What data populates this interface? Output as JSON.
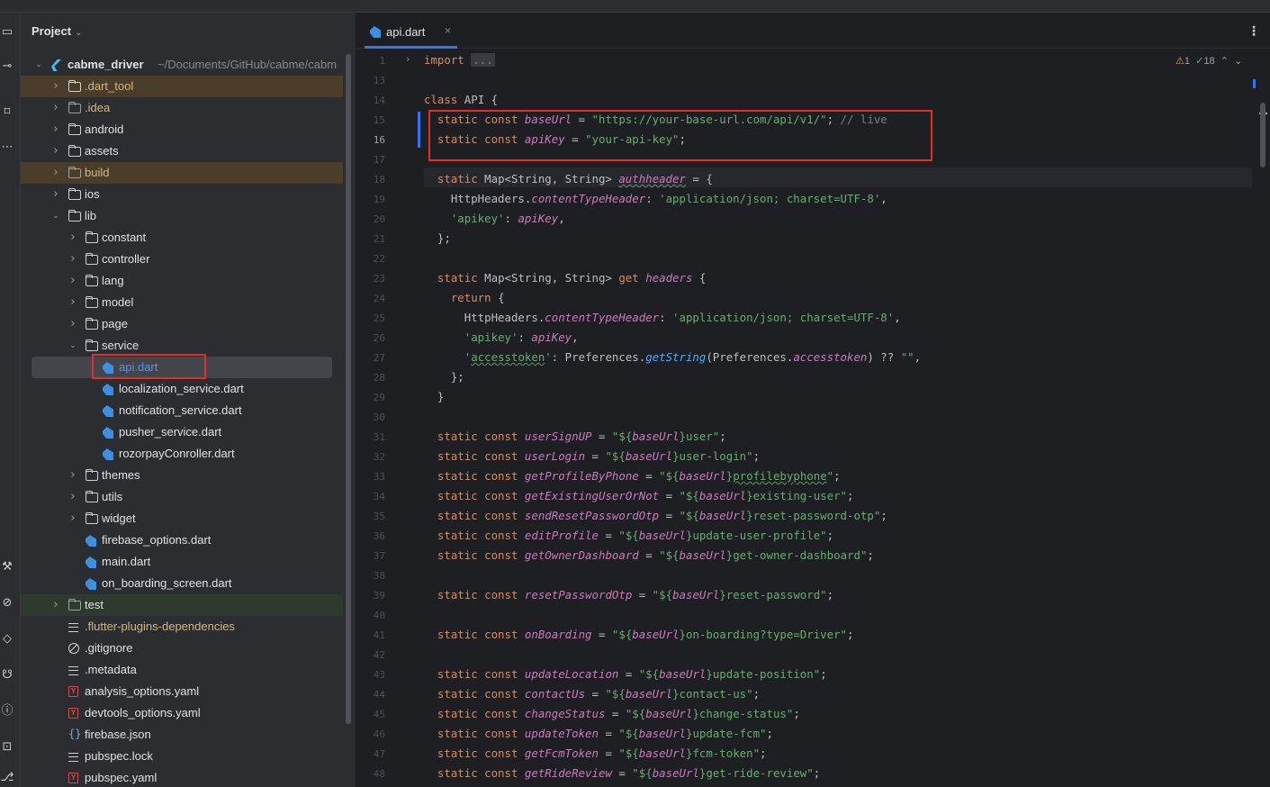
{
  "project_panel": {
    "title": "Project",
    "tree": [
      {
        "label": "cabme_driver",
        "path": "~/Documents/GitHub/cabme/cabm",
        "type": "flutter",
        "depth": 0,
        "arrow": "expanded"
      },
      {
        "label": ".dart_tool",
        "type": "folder",
        "depth": 1,
        "arrow": "collapsed",
        "style": "orange"
      },
      {
        "label": ".idea",
        "type": "folder",
        "depth": 1,
        "arrow": "collapsed",
        "style": "orange-text"
      },
      {
        "label": "android",
        "type": "folder",
        "depth": 1,
        "arrow": "collapsed"
      },
      {
        "label": "assets",
        "type": "folder",
        "depth": 1,
        "arrow": "collapsed"
      },
      {
        "label": "build",
        "type": "folder",
        "depth": 1,
        "arrow": "collapsed",
        "style": "orange"
      },
      {
        "label": "ios",
        "type": "folder",
        "depth": 1,
        "arrow": "collapsed"
      },
      {
        "label": "lib",
        "type": "folder",
        "depth": 1,
        "arrow": "expanded"
      },
      {
        "label": "constant",
        "type": "folder",
        "depth": 2,
        "arrow": "collapsed"
      },
      {
        "label": "controller",
        "type": "folder",
        "depth": 2,
        "arrow": "collapsed"
      },
      {
        "label": "lang",
        "type": "folder",
        "depth": 2,
        "arrow": "collapsed"
      },
      {
        "label": "model",
        "type": "folder",
        "depth": 2,
        "arrow": "collapsed"
      },
      {
        "label": "page",
        "type": "folder",
        "depth": 2,
        "arrow": "collapsed"
      },
      {
        "label": "service",
        "type": "folder",
        "depth": 2,
        "arrow": "expanded"
      },
      {
        "label": "api.dart",
        "type": "dart",
        "depth": 3,
        "style": "selected"
      },
      {
        "label": "localization_service.dart",
        "type": "dart",
        "depth": 3
      },
      {
        "label": "notification_service.dart",
        "type": "dart",
        "depth": 3
      },
      {
        "label": "pusher_service.dart",
        "type": "dart",
        "depth": 3
      },
      {
        "label": "rozorpayConroller.dart",
        "type": "dart",
        "depth": 3
      },
      {
        "label": "themes",
        "type": "folder",
        "depth": 2,
        "arrow": "collapsed"
      },
      {
        "label": "utils",
        "type": "folder",
        "depth": 2,
        "arrow": "collapsed"
      },
      {
        "label": "widget",
        "type": "folder",
        "depth": 2,
        "arrow": "collapsed"
      },
      {
        "label": "firebase_options.dart",
        "type": "dart",
        "depth": 2
      },
      {
        "label": "main.dart",
        "type": "dart",
        "depth": 2
      },
      {
        "label": "on_boarding_screen.dart",
        "type": "dart",
        "depth": 2
      },
      {
        "label": "test",
        "type": "folder",
        "depth": 1,
        "arrow": "collapsed",
        "style": "green"
      },
      {
        "label": ".flutter-plugins-dependencies",
        "type": "lines",
        "depth": 1,
        "style": "orange-text"
      },
      {
        "label": ".gitignore",
        "type": "ban",
        "depth": 1
      },
      {
        "label": ".metadata",
        "type": "lines",
        "depth": 1
      },
      {
        "label": "analysis_options.yaml",
        "type": "yaml",
        "depth": 1
      },
      {
        "label": "devtools_options.yaml",
        "type": "yaml",
        "depth": 1
      },
      {
        "label": "firebase.json",
        "type": "json",
        "depth": 1
      },
      {
        "label": "pubspec.lock",
        "type": "lines",
        "depth": 1
      },
      {
        "label": "pubspec.yaml",
        "type": "yaml",
        "depth": 1
      }
    ]
  },
  "editor": {
    "tab": {
      "label": "api.dart",
      "close": "×"
    },
    "more": "⋮",
    "inspections": {
      "warnings": "1",
      "ok": "18"
    },
    "line_numbers": [
      "1",
      "13",
      "14",
      "15",
      "16",
      "17",
      "18",
      "19",
      "20",
      "21",
      "22",
      "23",
      "24",
      "25",
      "26",
      "27",
      "28",
      "29",
      "30",
      "31",
      "32",
      "33",
      "34",
      "35",
      "36",
      "37",
      "38",
      "39",
      "40",
      "41",
      "42",
      "43",
      "44",
      "45",
      "46",
      "47",
      "48"
    ],
    "current_line": "16",
    "code": {
      "import_kw": "import",
      "import_fold": "...",
      "class_line": "class API {",
      "baseurl_field": "baseUrl",
      "baseurl_value": "\"https://your-base-url.com/api/v1/\"",
      "baseurl_comment": "// live",
      "apikey_field": "apiKey",
      "apikey_value": "\"your-api-key\"",
      "authheader_name": "authheader",
      "content_type_header": "contentTypeHeader",
      "json_charset": "'application/json; charset=UTF-8'",
      "apikey_key": "'apikey'",
      "headers_getter": "headers",
      "accesstoken_key": "accesstoken",
      "getstring": "getString",
      "accesstoken_field": "accesstoken",
      "endpoints": [
        {
          "name": "userSignUP",
          "path": "user"
        },
        {
          "name": "userLogin",
          "path": "user-login"
        },
        {
          "name": "getProfileByPhone",
          "path": "profilebyphone"
        },
        {
          "name": "getExistingUserOrNot",
          "path": "existing-user"
        },
        {
          "name": "sendResetPasswordOtp",
          "path": "reset-password-otp"
        },
        {
          "name": "editProfile",
          "path": "update-user-profile"
        },
        {
          "name": "getOwnerDashboard",
          "path": "get-owner-dashboard"
        },
        {
          "name": "resetPasswordOtp",
          "path": "reset-password"
        },
        {
          "name": "onBoarding",
          "path": "on-boarding?type=Driver"
        },
        {
          "name": "updateLocation",
          "path": "update-position"
        },
        {
          "name": "contactUs",
          "path": "contact-us"
        },
        {
          "name": "changeStatus",
          "path": "change-status"
        },
        {
          "name": "updateToken",
          "path": "update-fcm"
        },
        {
          "name": "getFcmToken",
          "path": "fcm-token"
        },
        {
          "name": "getRideReview",
          "path": "get-ride-review"
        }
      ]
    }
  }
}
